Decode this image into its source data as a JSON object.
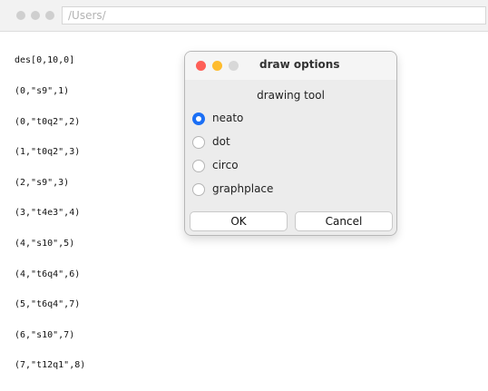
{
  "main_window": {
    "title": "/Users/",
    "code_lines": [
      "des[0,10,0]",
      "(0,\"s9\",1)",
      "(0,\"t0q2\",2)",
      "(1,\"t0q2\",3)",
      "(2,\"s9\",3)",
      "(3,\"t4e3\",4)",
      "(4,\"s10\",5)",
      "(4,\"t6q4\",6)",
      "(5,\"t6q4\",7)",
      "(6,\"s10\",7)",
      "(7,\"t12q1\",8)"
    ]
  },
  "dialog": {
    "title": "draw options",
    "section_title": "drawing tool",
    "options": [
      {
        "label": "neato",
        "selected": true
      },
      {
        "label": "dot",
        "selected": false
      },
      {
        "label": "circo",
        "selected": false
      },
      {
        "label": "graphplace",
        "selected": false
      }
    ],
    "buttons": {
      "ok_label": "OK",
      "cancel_label": "Cancel"
    }
  },
  "colors": {
    "accent": "#1b6ff5",
    "close": "#fe5f57",
    "minimize": "#febc2e",
    "inactive_light": "#d8d8d8"
  },
  "icons": {
    "main_close": "close-icon",
    "main_minimize": "minimize-icon",
    "main_zoom": "zoom-icon",
    "dialog_close": "close-icon",
    "dialog_minimize": "minimize-icon",
    "dialog_zoom": "zoom-icon"
  }
}
